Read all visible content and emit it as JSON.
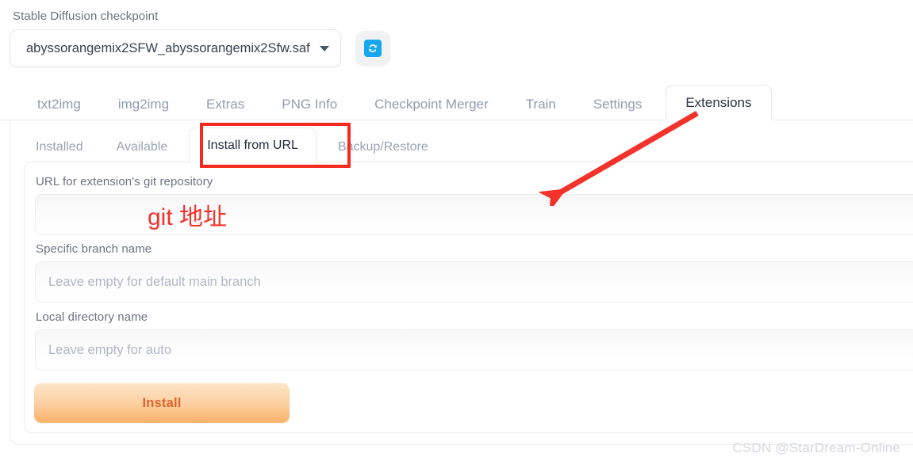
{
  "checkpoint": {
    "label": "Stable Diffusion checkpoint",
    "value": "abyssorangemix2SFW_abyssorangemix2Sfw.saf",
    "refresh_icon": "refresh-icon",
    "caret_icon": "chevron-down-icon",
    "accent": "#16a6f0"
  },
  "main_tabs": [
    {
      "label": "txt2img",
      "active": false
    },
    {
      "label": "img2img",
      "active": false
    },
    {
      "label": "Extras",
      "active": false
    },
    {
      "label": "PNG Info",
      "active": false
    },
    {
      "label": "Checkpoint Merger",
      "active": false
    },
    {
      "label": "Train",
      "active": false
    },
    {
      "label": "Settings",
      "active": false
    },
    {
      "label": "Extensions",
      "active": true
    }
  ],
  "sub_tabs": [
    {
      "label": "Installed",
      "active": false
    },
    {
      "label": "Available",
      "active": false
    },
    {
      "label": "Install from URL",
      "active": true
    },
    {
      "label": "Backup/Restore",
      "active": false
    }
  ],
  "form": {
    "url_field": {
      "label": "URL for extension's git repository",
      "value": "",
      "placeholder": ""
    },
    "branch_field": {
      "label": "Specific branch name",
      "value": "",
      "placeholder": "Leave empty for default main branch"
    },
    "directory_field": {
      "label": "Local directory name",
      "value": "",
      "placeholder": "Leave empty for auto"
    },
    "install_button": {
      "label": "Install",
      "text_color": "#e0632a"
    }
  },
  "annotations": {
    "highlight_color": "#f52a1e",
    "note_text": "git 地址",
    "arrow_color": "#f3322b",
    "highlight_target": "Install from URL"
  },
  "watermark": {
    "text": "CSDN @StarDream-Online"
  }
}
